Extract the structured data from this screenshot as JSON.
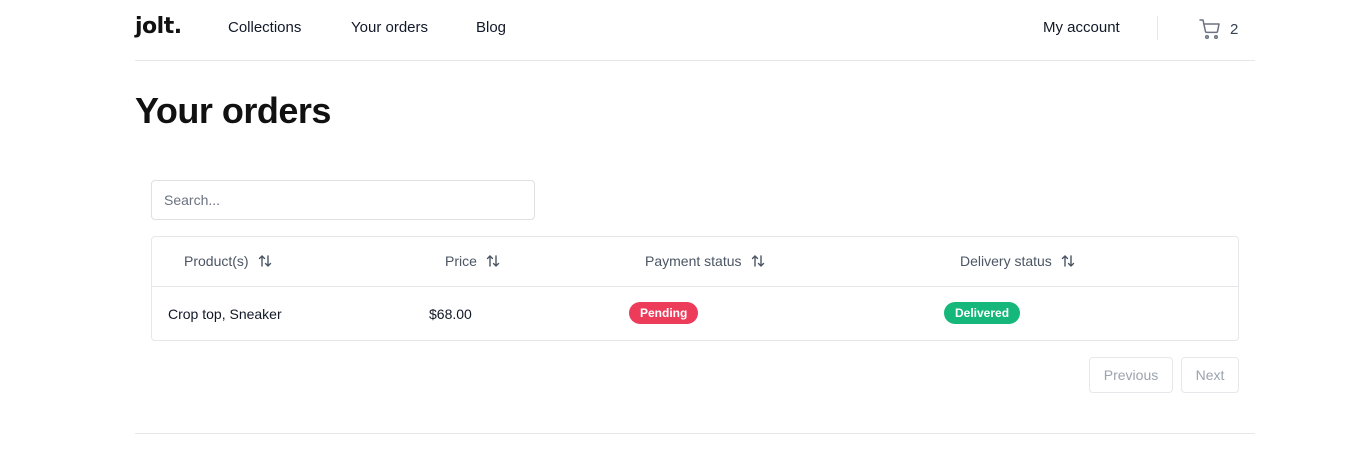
{
  "header": {
    "logo": "jolt.",
    "nav": [
      {
        "label": "Collections"
      },
      {
        "label": "Your orders"
      },
      {
        "label": "Blog"
      }
    ],
    "account_label": "My account",
    "cart_icon": "cart-icon",
    "cart_count": "2"
  },
  "page": {
    "title": "Your orders"
  },
  "search": {
    "placeholder": "Search...",
    "value": ""
  },
  "table": {
    "sort_icon": "sort-arrows-icon",
    "columns": [
      "Product(s)",
      "Price",
      "Payment status",
      "Delivery status"
    ],
    "rows": [
      {
        "products": "Crop top, Sneaker",
        "price": "$68.00",
        "payment_status": "Pending",
        "delivery_status": "Delivered"
      }
    ]
  },
  "pagination": {
    "previous_label": "Previous",
    "next_label": "Next"
  },
  "colors": {
    "pending": "#ec3c5a",
    "delivered": "#16b77a",
    "border": "#e5e7eb"
  }
}
